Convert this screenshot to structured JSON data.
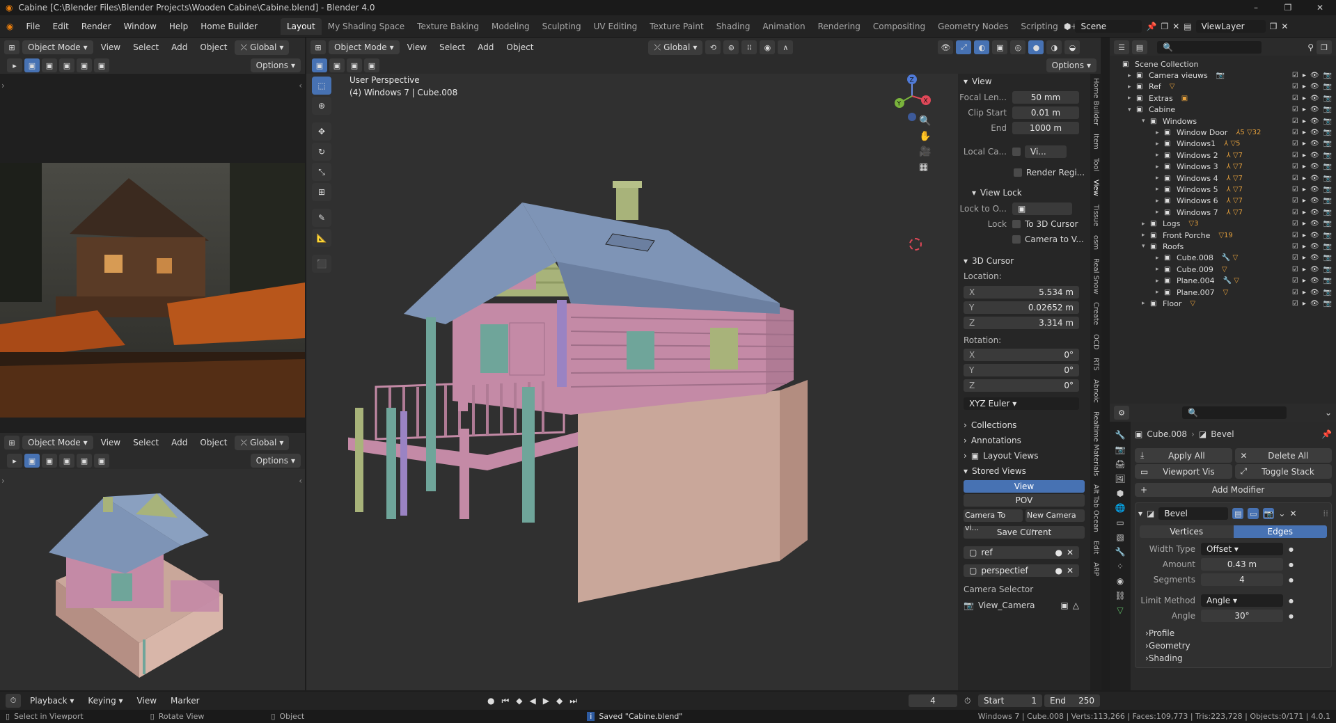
{
  "titlebar": {
    "title": "Cabine [C:\\Blender Files\\Blender Projects\\Wooden Cabine\\Cabine.blend] - Blender 4.0",
    "minimize": "–",
    "maximize": "❐",
    "close": "✕"
  },
  "menu": {
    "items": [
      "File",
      "Edit",
      "Render",
      "Window",
      "Help",
      "Home Builder"
    ],
    "workspaces": [
      "Layout",
      "My Shading Space",
      "Texture Baking",
      "Modeling",
      "Sculpting",
      "UV Editing",
      "Texture Paint",
      "Shading",
      "Animation",
      "Rendering",
      "Compositing",
      "Geometry Nodes",
      "Scripting"
    ],
    "plus": "+",
    "scene": "Scene",
    "view_layer": "ViewLayer"
  },
  "header": {
    "mode": "Object Mode",
    "view": "View",
    "select": "Select",
    "add": "Add",
    "object": "Object",
    "orientation": "Global",
    "options": "Options"
  },
  "viewport": {
    "perspective": "User Perspective",
    "object_info": "(4) Windows 7 | Cube.008",
    "axis_x": "X",
    "axis_y": "Y",
    "axis_z": "Z"
  },
  "npanel": {
    "view_section": "View",
    "focal_label": "Focal Len...",
    "focal": "50 mm",
    "clip_start_label": "Clip Start",
    "clip_start": "0.01 m",
    "end_label": "End",
    "clip_end": "1000 m",
    "local_cam_label": "Local Ca...",
    "local_cam": "Vi...",
    "render_region": "Render Regi...",
    "view_lock": "View Lock",
    "lock_to_label": "Lock to O...",
    "lock_label": "Lock",
    "to_cursor": "To 3D Cursor",
    "camera_to_view": "Camera to V...",
    "cursor_section": "3D Cursor",
    "location_label": "Location:",
    "loc_x": "5.534 m",
    "loc_y": "0.02652 m",
    "loc_z": "3.314 m",
    "rotation_label": "Rotation:",
    "rot_x": "0°",
    "rot_y": "0°",
    "rot_z": "0°",
    "rot_mode": "XYZ Euler",
    "collections": "Collections",
    "annotations": "Annotations",
    "layout_views": "Layout Views",
    "stored_views": "Stored Views",
    "view_btn": "View",
    "pov_btn": "POV",
    "camera_to_vi": "Camera To vi...",
    "new_camera": "New Camera ...",
    "save_current": "Save Current",
    "slot_ref": "ref",
    "slot_persp": "perspectief",
    "camera_selector": "Camera Selector",
    "camera_name": "View_Camera",
    "tabs": [
      "Home Builder",
      "Item",
      "Tool",
      "View",
      "Tissue",
      "osm",
      "Real Snow",
      "Create",
      "OCD",
      "RTS",
      "Abnoic",
      "Realtime Materials",
      "Alt Tab Ocean",
      "Edit",
      "ARP"
    ],
    "x": "X",
    "y": "Y",
    "z": "Z"
  },
  "outliner": {
    "root": "Scene Collection",
    "rows": [
      {
        "label": "Camera vieuws",
        "depth": 1,
        "tri": "▸",
        "extra": "📷"
      },
      {
        "label": "Ref",
        "depth": 1,
        "tri": "▸",
        "extra": "▽"
      },
      {
        "label": "Extras",
        "depth": 1,
        "tri": "▸",
        "extra": "▣"
      },
      {
        "label": "Cabine",
        "depth": 1,
        "tri": "▾",
        "extra": ""
      },
      {
        "label": "Windows",
        "depth": 2,
        "tri": "▾",
        "extra": ""
      },
      {
        "label": "Window Door",
        "depth": 3,
        "tri": "▸",
        "extra": "⅄5 ▽32"
      },
      {
        "label": "Windows1",
        "depth": 3,
        "tri": "▸",
        "extra": "⅄ ▽5"
      },
      {
        "label": "Windows 2",
        "depth": 3,
        "tri": "▸",
        "extra": "⅄ ▽7"
      },
      {
        "label": "Windows 3",
        "depth": 3,
        "tri": "▸",
        "extra": "⅄ ▽7"
      },
      {
        "label": "Windows 4",
        "depth": 3,
        "tri": "▸",
        "extra": "⅄ ▽7"
      },
      {
        "label": "Windows 5",
        "depth": 3,
        "tri": "▸",
        "extra": "⅄ ▽7"
      },
      {
        "label": "Windows 6",
        "depth": 3,
        "tri": "▸",
        "extra": "⅄ ▽7"
      },
      {
        "label": "Windows 7",
        "depth": 3,
        "tri": "▸",
        "extra": "⅄ ▽7"
      },
      {
        "label": "Logs",
        "depth": 2,
        "tri": "▸",
        "extra": "▽3"
      },
      {
        "label": "Front Porche",
        "depth": 2,
        "tri": "▸",
        "extra": "▽19"
      },
      {
        "label": "Roofs",
        "depth": 2,
        "tri": "▾",
        "extra": ""
      },
      {
        "label": "Cube.008",
        "depth": 3,
        "tri": "▸",
        "extra": "🔧 ▽"
      },
      {
        "label": "Cube.009",
        "depth": 3,
        "tri": "▸",
        "extra": "▽"
      },
      {
        "label": "Plane.004",
        "depth": 3,
        "tri": "▸",
        "extra": "🔧 ▽"
      },
      {
        "label": "Plane.007",
        "depth": 3,
        "tri": "▸",
        "extra": "▽"
      },
      {
        "label": "Floor",
        "depth": 2,
        "tri": "▸",
        "extra": "▽"
      }
    ]
  },
  "props": {
    "crumb_obj": "Cube.008",
    "crumb_mod": "Bevel",
    "apply_all": "Apply All",
    "delete_all": "Delete All",
    "viewport_vis": "Viewport Vis",
    "toggle_stack": "Toggle Stack",
    "add_modifier": "Add Modifier",
    "mod_name": "Bevel",
    "vertices": "Vertices",
    "edges": "Edges",
    "width_type_label": "Width Type",
    "width_type": "Offset",
    "amount_label": "Amount",
    "amount": "0.43 m",
    "segments_label": "Segments",
    "segments": "4",
    "limit_label": "Limit Method",
    "limit": "Angle",
    "angle_label": "Angle",
    "angle": "30°",
    "profile": "Profile",
    "geometry": "Geometry",
    "shading": "Shading"
  },
  "timeline": {
    "playback": "Playback",
    "keying": "Keying",
    "view": "View",
    "marker": "Marker",
    "frame": "4",
    "start_label": "Start",
    "start": "1",
    "end_label": "End",
    "end": "250"
  },
  "status": {
    "select": "Select in Viewport",
    "rotate": "Rotate View",
    "object": "Object",
    "saved": "Saved \"Cabine.blend\"",
    "stats": "Windows 7 | Cube.008 | Verts:113,266 | Faces:109,773 | Tris:223,728 | Objects:0/171 | 4.0.1"
  },
  "colors": {
    "accent": "#4772b3",
    "roof": "#7e94b6",
    "log_pink": "#c48aa6",
    "siding_green": "#a8b37a",
    "foundation": "#c9a79a",
    "purple_post": "#9a83c3",
    "teal": "#6fa59a",
    "photo_orange": "#b8561b"
  }
}
